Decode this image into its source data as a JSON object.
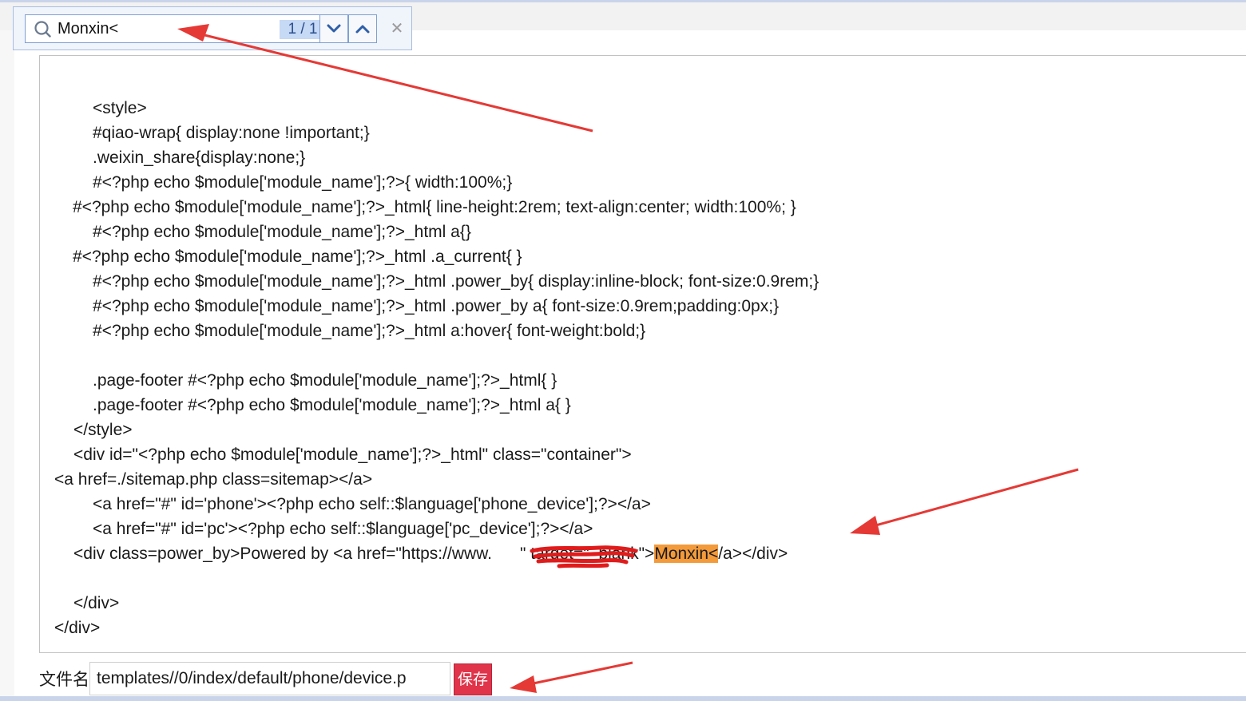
{
  "find_bar": {
    "query": "Monxin<",
    "match_count": "1 / 1",
    "icons": {
      "search": "search-icon",
      "next": "chevron-down-icon",
      "prev": "chevron-up-icon",
      "close": "close-icon"
    }
  },
  "editor": {
    "lines": [
      "<style>",
      "#qiao-wrap{ display:none !important;}",
      ".weixin_share{display:none;}",
      "#<?php echo $module['module_name'];?>{ width:100%;}",
      "#<?php echo $module['module_name'];?>_html{ line-height:2rem; text-align:center; width:100%; }",
      "#<?php echo $module['module_name'];?>_html a{}",
      "#<?php echo $module['module_name'];?>_html .a_current{ }",
      "#<?php echo $module['module_name'];?>_html .power_by{ display:inline-block; font-size:0.9rem;}",
      "#<?php echo $module['module_name'];?>_html .power_by a{ font-size:0.9rem;padding:0px;}",
      "#<?php echo $module['module_name'];?>_html a:hover{ font-weight:bold;}",
      "",
      ".page-footer #<?php echo $module['module_name'];?>_html{ }",
      ".page-footer #<?php echo $module['module_name'];?>_html a{ }",
      "</style>",
      "<div id=\"<?php echo $module['module_name'];?>_html\" class=\"container\">",
      "<a href=./sitemap.php class=sitemap></a>",
      "<a href=\"#\" id='phone'><?php echo self::$language['phone_device'];?></a>",
      "<a href=\"#\" id='pc'><?php echo self::$language['pc_device'];?></a>",
      "",
      "",
      "</div>",
      "</div>"
    ],
    "powered_line": {
      "before": "<div class=power_by>Powered by <a href=\"https://www.",
      "hidden": "      ",
      "after": "\" target=\"_blank\">",
      "match": "Monxin<",
      "rest": "/a></div>"
    }
  },
  "file_row": {
    "label": "文件名",
    "value": "templates//0/index/default/phone/device.p",
    "save_label": "保存"
  },
  "colors": {
    "match_highlight": "#f39a3b",
    "save_button": "#e0344a",
    "annotation_arrow": "#e53935"
  }
}
